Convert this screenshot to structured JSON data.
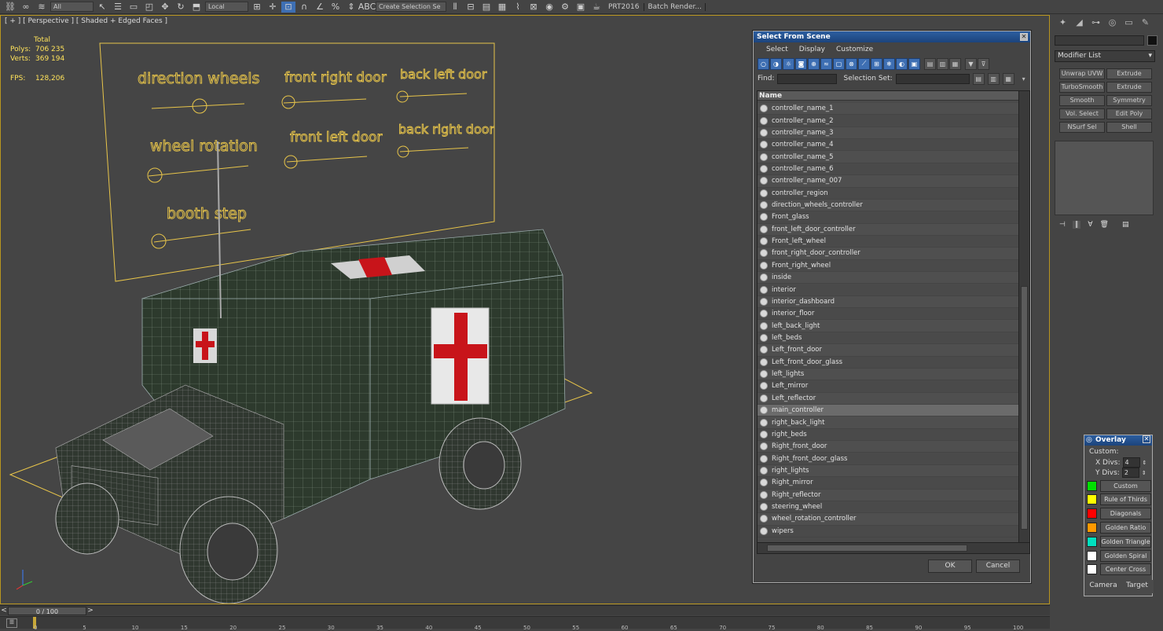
{
  "toolbar": {
    "filter_value": "All",
    "ref_coord": "Local",
    "selection_set_placeholder": "Create Selection Se",
    "plugin_label": "PRT2016",
    "batch_render_label": "Batch Render..."
  },
  "viewport": {
    "label": "[ + ] [ Perspective ] [ Shaded + Edged Faces ]",
    "stats": {
      "header": "Total",
      "polys_label": "Polys:",
      "polys_value": "706 235",
      "verts_label": "Verts:",
      "verts_value": "369 194",
      "fps_label": "FPS:",
      "fps_value": "128,206"
    },
    "controller_labels": [
      "direction wheels",
      "front right door",
      "back left door",
      "wheel rotation",
      "front left door",
      "back right door",
      "booth step"
    ]
  },
  "dialog": {
    "title": "Select From Scene",
    "menu": [
      "Select",
      "Display",
      "Customize"
    ],
    "find_label": "Find:",
    "selection_set_label": "Selection Set:",
    "column_name": "Name",
    "items": [
      "controller_name_1",
      "controller_name_2",
      "controller_name_3",
      "controller_name_4",
      "controller_name_5",
      "controller_name_6",
      "controller_name_007",
      "controller_region",
      "direction_wheels_controller",
      "Front_glass",
      "front_left_door_controller",
      "Front_left_wheel",
      "front_right_door_controller",
      "Front_right_wheel",
      "inside",
      "interior",
      "interior_dashboard",
      "interior_floor",
      "left_back_light",
      "left_beds",
      "Left_front_door",
      "Left_front_door_glass",
      "left_lights",
      "Left_mirror",
      "Left_reflector",
      "main_controller",
      "right_back_light",
      "right_beds",
      "Right_front_door",
      "Right_front_door_glass",
      "right_lights",
      "Right_mirror",
      "Right_reflector",
      "steering_wheel",
      "wheel_rotation_controller",
      "wipers"
    ],
    "selected_item": "main_controller",
    "ok_label": "OK",
    "cancel_label": "Cancel"
  },
  "command_panel": {
    "modifier_list": "Modifier List",
    "modifier_buttons": [
      "Unwrap UVW",
      "Extrude",
      "TurboSmooth",
      "Extrude",
      "Smooth",
      "Symmetry",
      "Vol. Select",
      "Edit Poly",
      "NSurf Sel",
      "Shell"
    ]
  },
  "overlay": {
    "title": "Overlay",
    "custom_label": "Custom:",
    "xdivs_label": "X Divs:",
    "xdivs_value": "4",
    "ydivs_label": "Y Divs:",
    "ydivs_value": "2",
    "items": [
      {
        "label": "Custom",
        "color": "#00e000"
      },
      {
        "label": "Rule of Thirds",
        "color": "#ffff00"
      },
      {
        "label": "Diagonals",
        "color": "#ff0000"
      },
      {
        "label": "Golden Ratio",
        "color": "#ff9900"
      },
      {
        "label": "Golden Triangle",
        "color": "#00e0c0"
      },
      {
        "label": "Golden Spiral",
        "color": "#ffffff"
      },
      {
        "label": "Center Cross",
        "color": "#ffffff"
      }
    ],
    "camera_label": "Camera",
    "target_label": "Target"
  },
  "timeline": {
    "frame_text": "0 / 100",
    "ticks": [
      "0",
      "5",
      "10",
      "15",
      "20",
      "25",
      "30",
      "35",
      "40",
      "45",
      "50",
      "55",
      "60",
      "65",
      "70",
      "75",
      "80",
      "85",
      "90",
      "95",
      "100"
    ]
  }
}
